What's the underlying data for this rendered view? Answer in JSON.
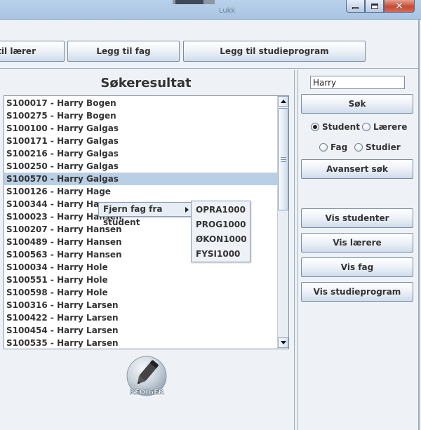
{
  "background_window": {
    "text": "Lukk"
  },
  "toolbar": {
    "add_teacher_label": "Legg til lærer",
    "add_subject_label": "Legg til fag",
    "add_program_label": "Legg til studieprogram"
  },
  "results": {
    "title": "Søkeresultat",
    "items": [
      "S100017 - Harry Bogen",
      "S100275 - Harry Bogen",
      "S100100 - Harry Galgas",
      "S100171 - Harry Galgas",
      "S100216 - Harry Galgas",
      "S100250 - Harry Galgas",
      "S100570 - Harry Galgas",
      "S100126 - Harry Hage",
      "S100344 - Harry Hage",
      "S100023 - Harry Hansen",
      "S100207 - Harry Hansen",
      "S100489 - Harry Hansen",
      "S100563 - Harry Hansen",
      "S100034 - Harry Hole",
      "S100551 - Harry Hole",
      "S100598 - Harry Hole",
      "S100316 - Harry Larsen",
      "S100422 - Harry Larsen",
      "S100454 - Harry Larsen",
      "S100535 - Harry Larsen"
    ],
    "selected_index": 6,
    "edit_icon_text": "REDIGER"
  },
  "context_menu": {
    "item": "Fjern fag fra student",
    "submenu": [
      "OPRA1000",
      "PROG1000",
      "ØKON1000",
      "FYSI1000"
    ]
  },
  "search": {
    "value": "Harry",
    "button_label": "Søk",
    "radio_student": "Student",
    "radio_teacher": "Lærere",
    "radio_subject": "Fag",
    "radio_studies": "Studier",
    "selected": "Student",
    "advanced_label": "Avansert søk"
  },
  "views": {
    "students_label": "Vis studenter",
    "teachers_label": "Vis lærere",
    "subjects_label": "Vis fag",
    "programs_label": "Vis studieprogram"
  },
  "colors": {
    "selection": "#b8cfe5",
    "button_top": "#ffffff",
    "button_bottom": "#cfdcec",
    "close_button": "#c74a35"
  }
}
